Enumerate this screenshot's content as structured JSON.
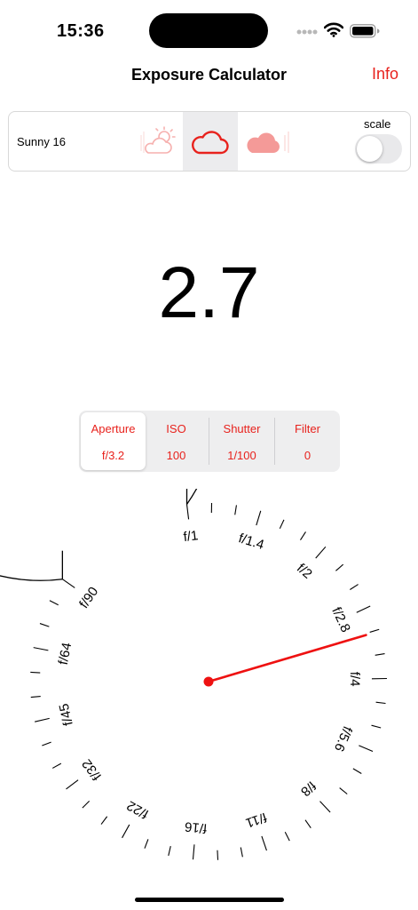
{
  "status": {
    "time": "15:36"
  },
  "nav": {
    "title": "Exposure Calculator",
    "info_label": "Info"
  },
  "weather": {
    "label": "Sunny 16",
    "options": [
      "partly-cloudy-icon",
      "cloud-icon",
      "heavy-cloud-icon"
    ],
    "selected_index": 1,
    "scale_label": "scale",
    "scale_on": false
  },
  "ev": {
    "value": "2.7"
  },
  "tabs": [
    {
      "label": "Aperture",
      "value": "f/3.2"
    },
    {
      "label": "ISO",
      "value": "100"
    },
    {
      "label": "Shutter",
      "value": "1/100"
    },
    {
      "label": "Filter",
      "value": "0"
    }
  ],
  "dial": {
    "labels": [
      "f/1",
      "f/1.4",
      "f/2",
      "f/2.8",
      "f/4",
      "f/5.6",
      "f/8",
      "f/11",
      "f/16",
      "f/22",
      "f/32",
      "f/45",
      "f/64",
      "f/90"
    ],
    "selected": "f/3.2"
  },
  "colors": {
    "accent": "#e8221d",
    "pointer": "#ee1111",
    "segment_bg": "#eeeeef"
  }
}
